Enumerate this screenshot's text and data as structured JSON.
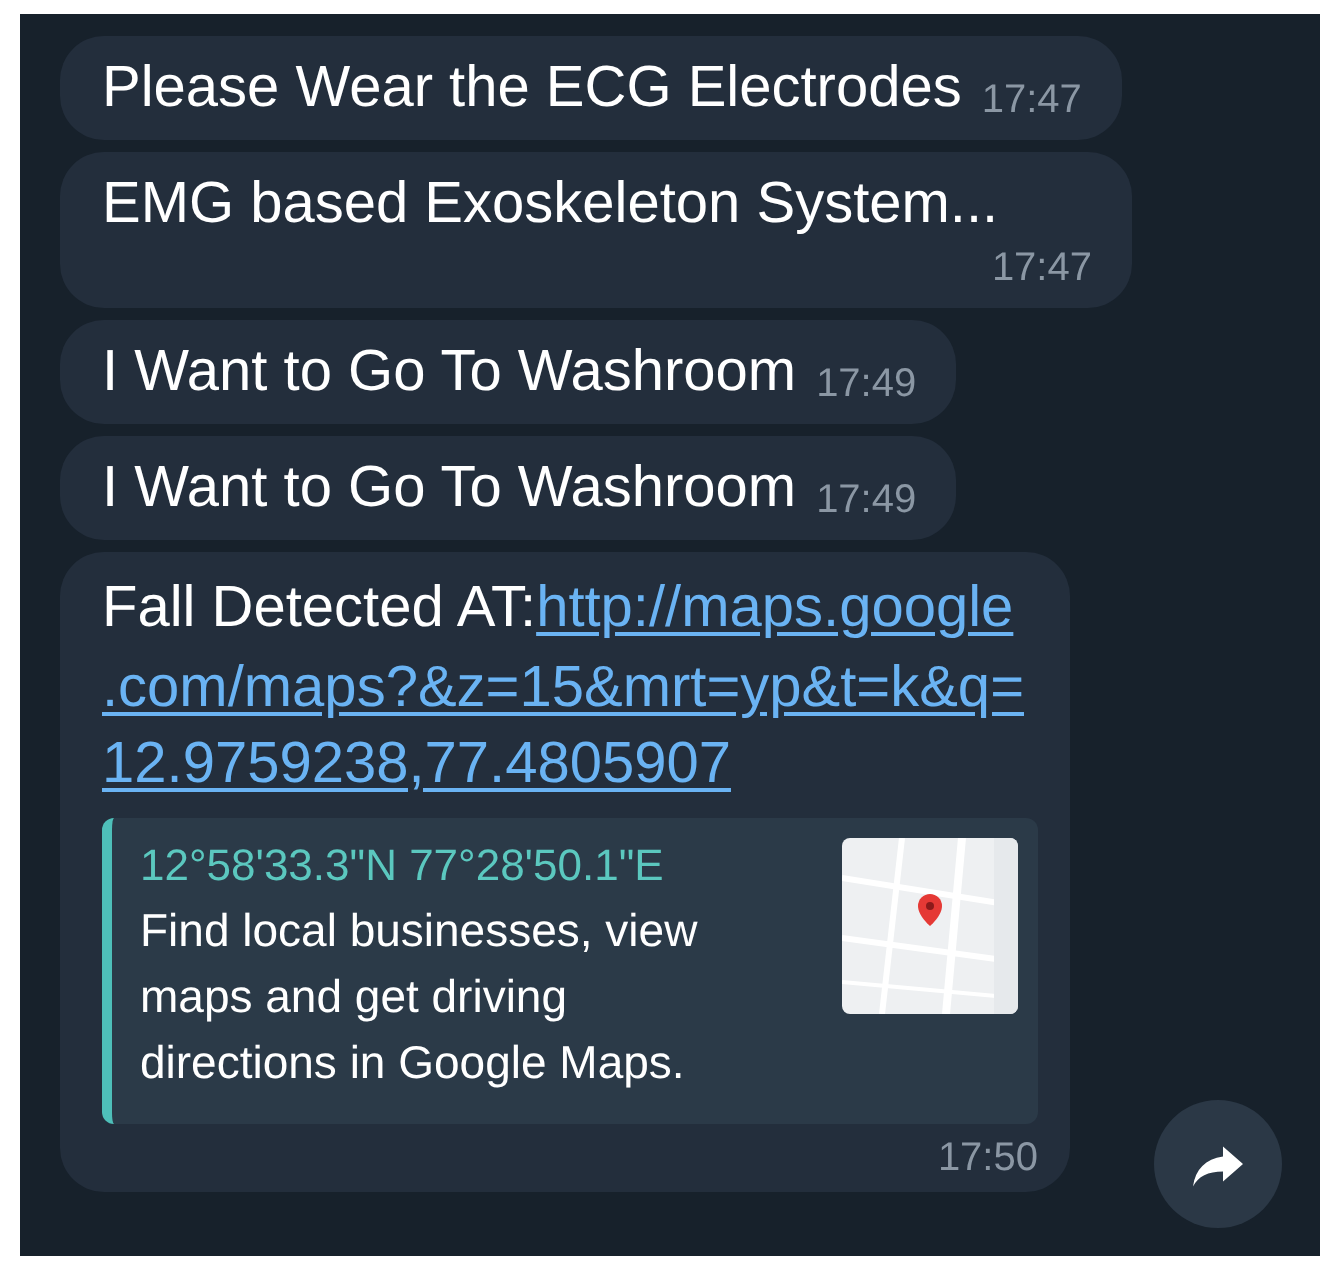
{
  "messages": [
    {
      "kind": "text",
      "text": "Please Wear the ECG Electrodes",
      "time": "17:47"
    },
    {
      "kind": "text",
      "text": "EMG based Exoskeleton System...",
      "time": "17:47"
    },
    {
      "kind": "text",
      "text": "I Want to Go To Washroom",
      "time": "17:49"
    },
    {
      "kind": "text",
      "text": "I Want to Go To Washroom",
      "time": "17:49"
    },
    {
      "kind": "link",
      "text": "Fall Detected AT:",
      "link_lines": [
        "http://maps.google",
        ".com/maps?&z=15&mrt=yp&t=k&q=",
        "12.9759238,77.4805907"
      ],
      "preview": {
        "title": "12°58'33.3\"N 77°28'50.1\"E",
        "description": "Find local businesses, view maps and get driving directions in Google Maps."
      },
      "time": "17:50"
    }
  ]
}
